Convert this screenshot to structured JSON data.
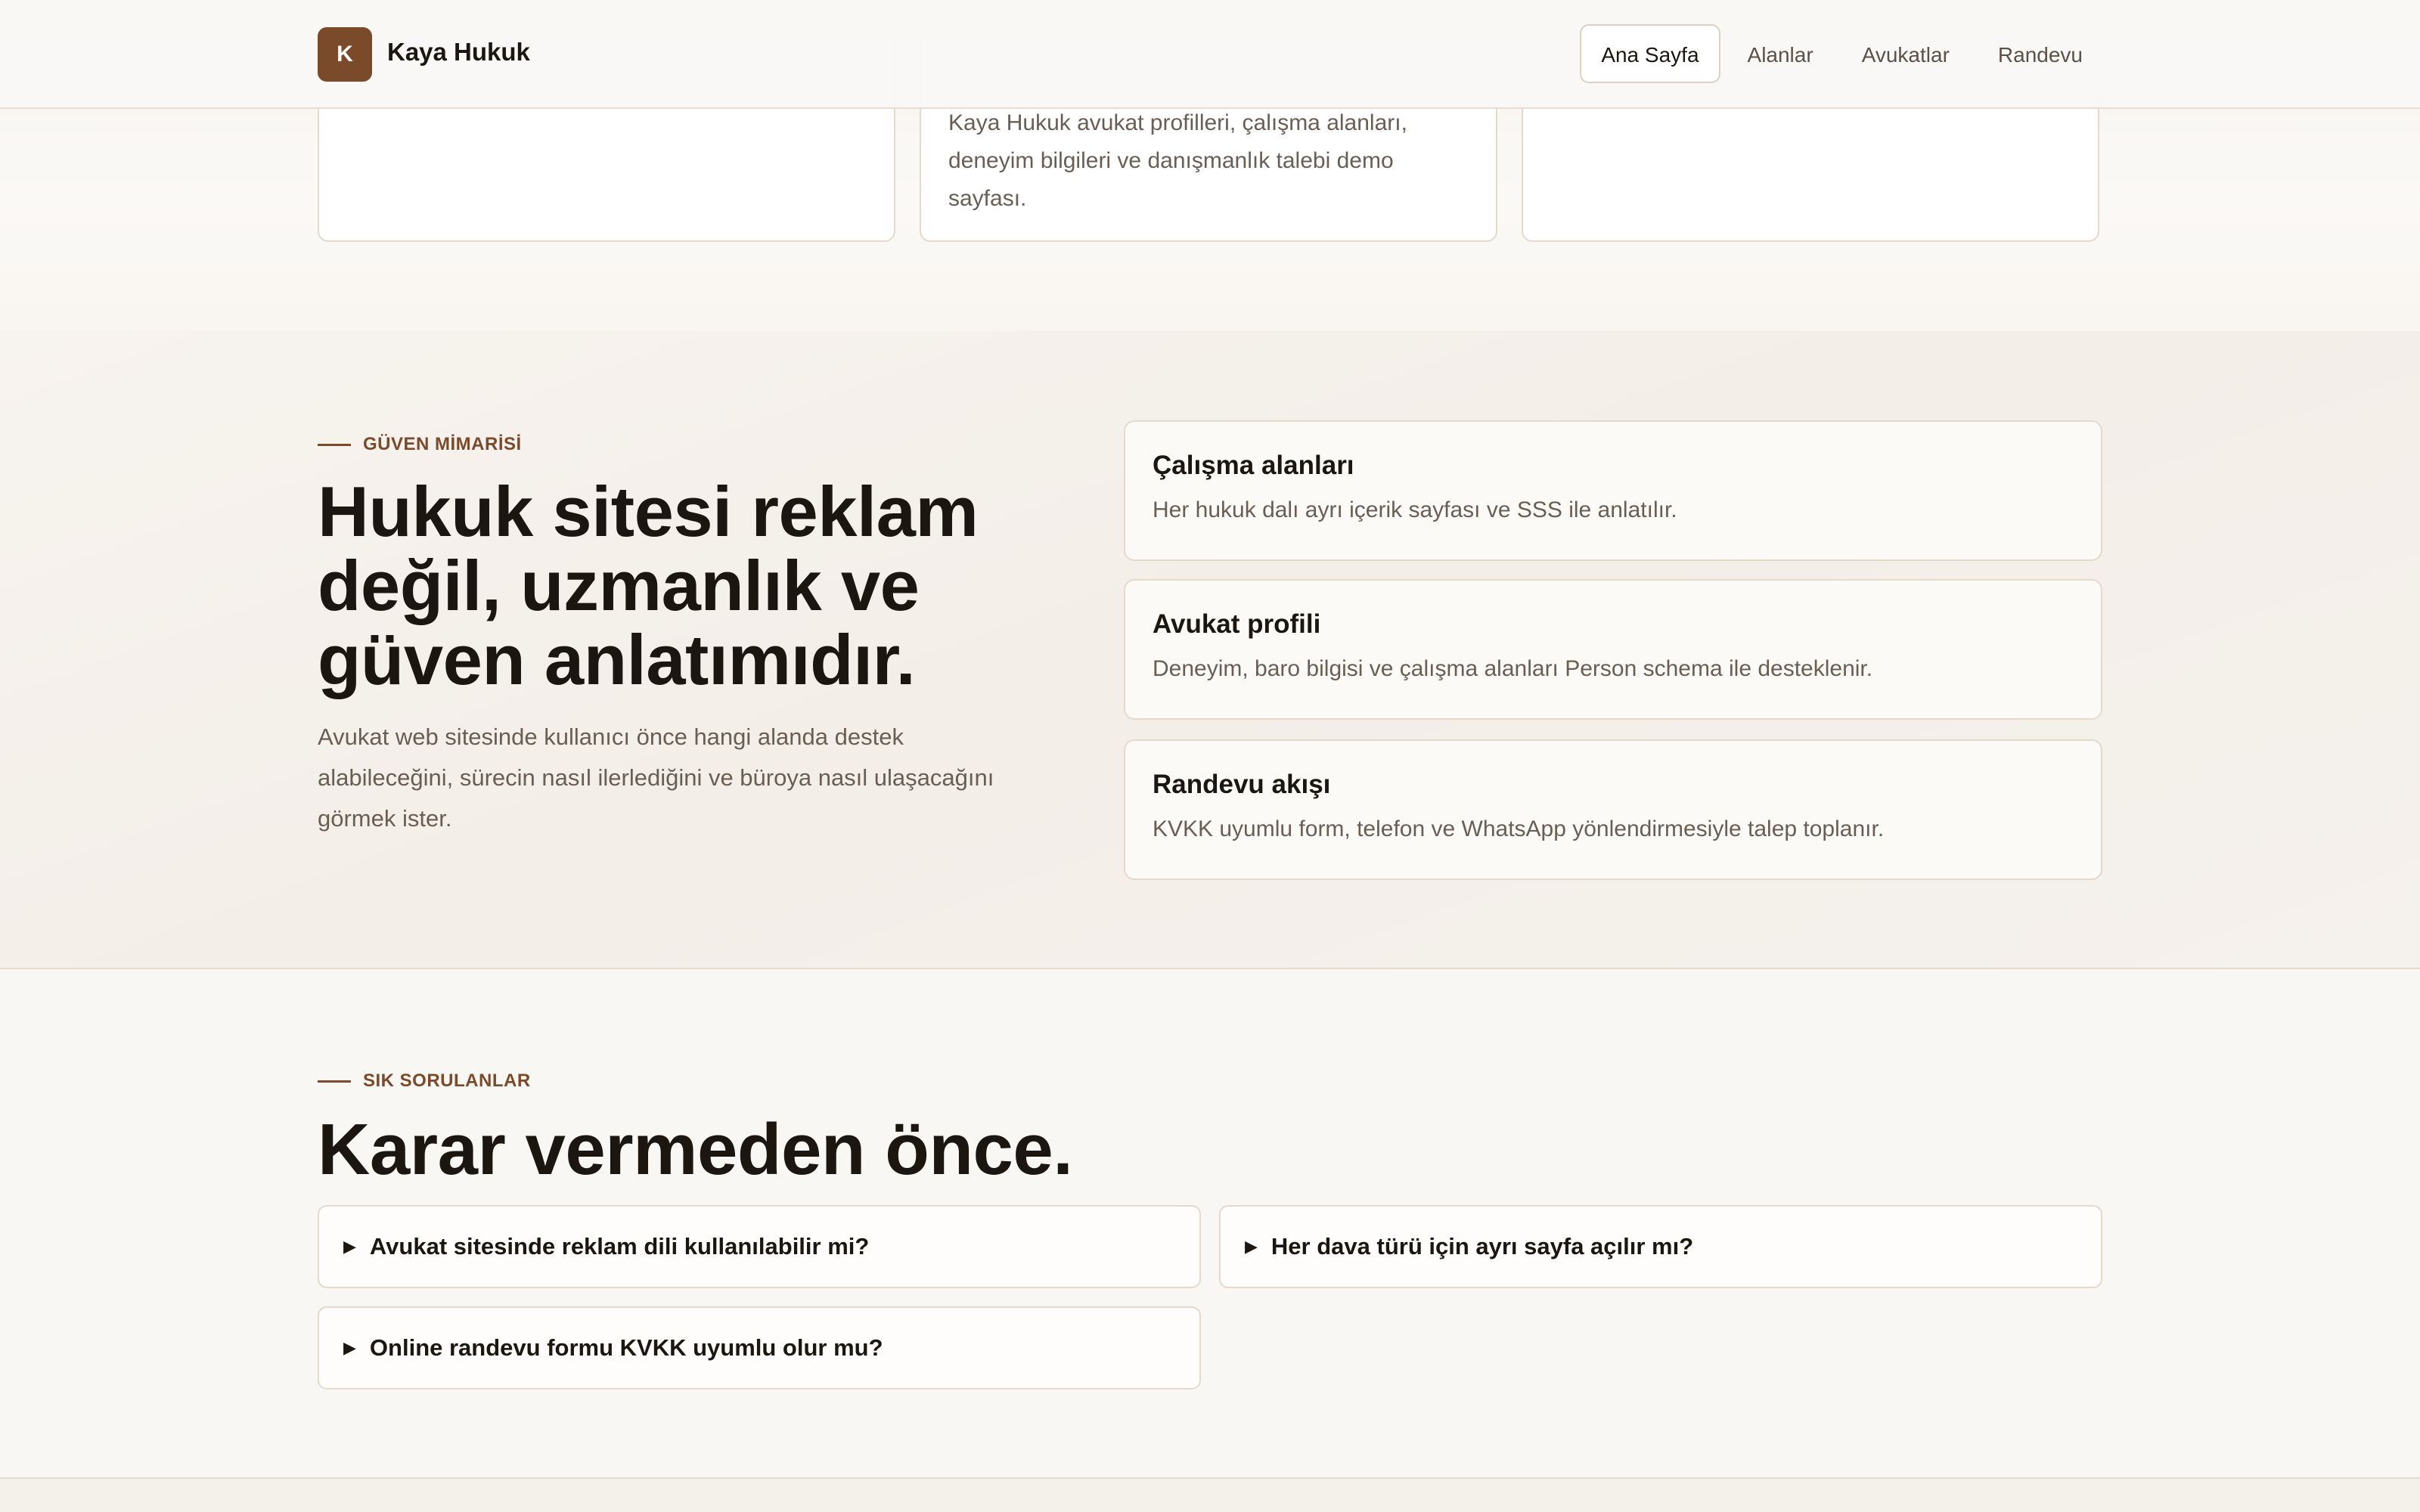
{
  "header": {
    "logo_letter": "K",
    "brand": "Kaya Hukuk",
    "nav": [
      {
        "label": "Ana Sayfa",
        "active": true
      },
      {
        "label": "Alanlar",
        "active": false
      },
      {
        "label": "Avukatlar",
        "active": false
      },
      {
        "label": "Randevu",
        "active": false
      }
    ]
  },
  "top_cards": {
    "middle_text": "Kaya Hukuk avukat profilleri, çalışma alanları, deneyim bilgileri ve danışmanlık talebi demo sayfası."
  },
  "trust": {
    "eyebrow": "GÜVEN MİMARİSİ",
    "title": "Hukuk sitesi reklam değil, uzmanlık ve güven anlatımıdır.",
    "description": "Avukat web sitesinde kullanıcı önce hangi alanda destek alabileceğini, sürecin nasıl ilerlediğini ve büroya nasıl ulaşacağını görmek ister.",
    "features": [
      {
        "title": "Çalışma alanları",
        "desc": "Her hukuk dalı ayrı içerik sayfası ve SSS ile anlatılır."
      },
      {
        "title": "Avukat profili",
        "desc": "Deneyim, baro bilgisi ve çalışma alanları Person schema ile desteklenir."
      },
      {
        "title": "Randevu akışı",
        "desc": "KVKK uyumlu form, telefon ve WhatsApp yönlendirmesiyle talep toplanır."
      }
    ]
  },
  "faq": {
    "eyebrow": "SIK SORULANLAR",
    "title": "Karar vermeden önce.",
    "items": [
      {
        "question": "Avukat sitesinde reklam dili kullanılabilir mi?"
      },
      {
        "question": "Her dava türü için ayrı sayfa açılır mı?"
      },
      {
        "question": "Online randevu formu KVKK uyumlu olur mu?"
      }
    ]
  },
  "colors": {
    "accent": "#7a4a2a",
    "text": "#1c1611",
    "muted": "#6a5e54",
    "border": "#e4d9cb",
    "background": "#f8f5f0"
  }
}
